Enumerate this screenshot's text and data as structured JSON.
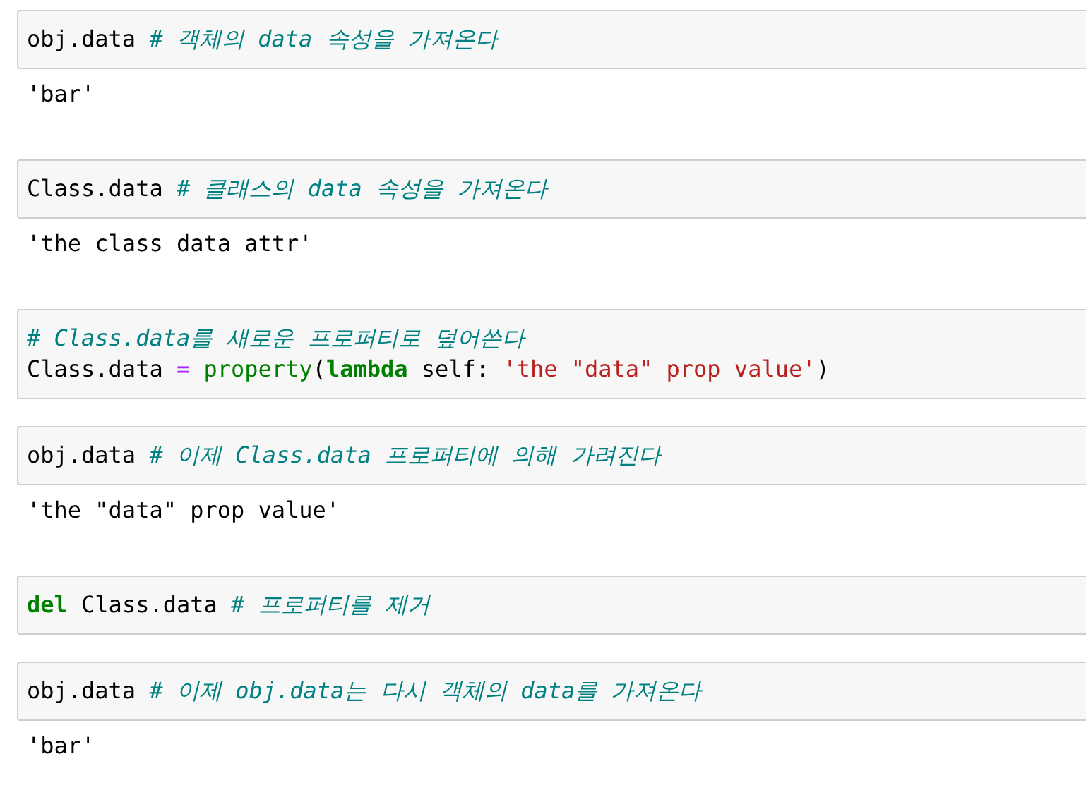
{
  "cells": [
    {
      "input": [
        [
          {
            "kind": "plain",
            "text": "obj.data "
          },
          {
            "kind": "comment",
            "text": "# 객체의 data 속성을 가져온다"
          }
        ]
      ],
      "output": "'bar'"
    },
    {
      "input": [
        [
          {
            "kind": "plain",
            "text": "Class.data "
          },
          {
            "kind": "comment",
            "text": "# 클래스의 data 속성을 가져온다"
          }
        ]
      ],
      "output": "'the class data attr'"
    },
    {
      "input": [
        [
          {
            "kind": "comment",
            "text": "# Class.data를 새로운 프로퍼티로 덮어쓴다"
          }
        ],
        [
          {
            "kind": "plain",
            "text": "Class.data "
          },
          {
            "kind": "operator",
            "text": "= "
          },
          {
            "kind": "builtin",
            "text": "property"
          },
          {
            "kind": "plain",
            "text": "("
          },
          {
            "kind": "keyword",
            "text": "lambda"
          },
          {
            "kind": "plain",
            "text": " self: "
          },
          {
            "kind": "string",
            "text": "'the \"data\" prop value'"
          },
          {
            "kind": "plain",
            "text": ")"
          }
        ]
      ]
    },
    {
      "input": [
        [
          {
            "kind": "plain",
            "text": "obj.data "
          },
          {
            "kind": "comment",
            "text": "# 이제 Class.data 프로퍼티에 의해 가려진다"
          }
        ]
      ],
      "output": "'the \"data\" prop value'"
    },
    {
      "input": [
        [
          {
            "kind": "keyword",
            "text": "del"
          },
          {
            "kind": "plain",
            "text": " Class.data "
          },
          {
            "kind": "comment",
            "text": "# 프로퍼티를 제거"
          }
        ]
      ]
    },
    {
      "input": [
        [
          {
            "kind": "plain",
            "text": "obj.data "
          },
          {
            "kind": "comment",
            "text": "# 이제 obj.data는 다시 객체의 data를 가져온다"
          }
        ]
      ],
      "output": "'bar'"
    }
  ]
}
